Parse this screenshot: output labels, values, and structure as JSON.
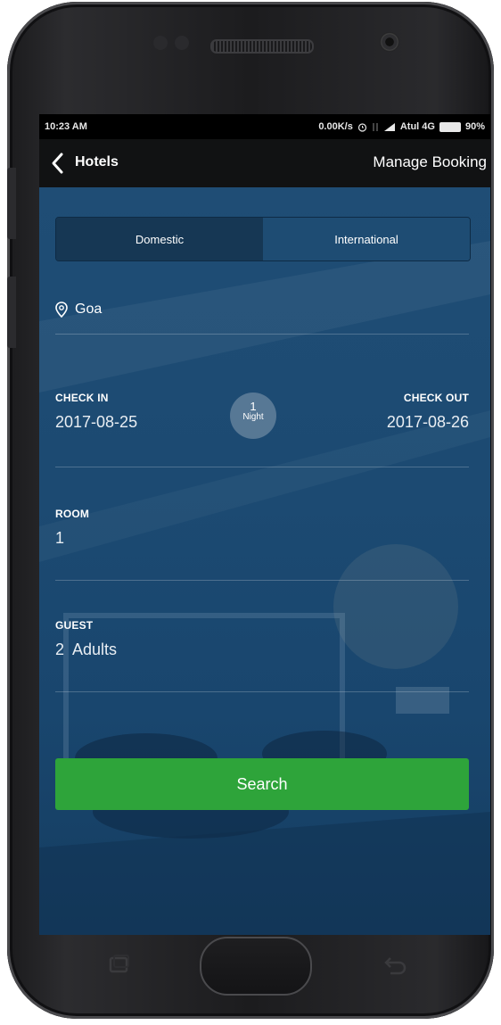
{
  "status_bar": {
    "time": "10:23 AM",
    "net_speed": "0.00K/s",
    "carrier": "Atul 4G",
    "battery": "90%",
    "icons": [
      "alarm-icon",
      "transfer-icon",
      "signal-icon",
      "battery-icon"
    ]
  },
  "app_bar": {
    "title": "Hotels",
    "manage_label": "Manage Booking",
    "back_icon": "chevron-left-icon"
  },
  "tabs": {
    "domestic": "Domestic",
    "international": "International",
    "selected": "Domestic"
  },
  "location": {
    "icon": "location-pin-icon",
    "value": "Goa"
  },
  "dates": {
    "check_in_label": "CHECK IN",
    "check_in_value": "2017-08-25",
    "check_out_label": "CHECK OUT",
    "check_out_value": "2017-08-26",
    "nights_count": "1",
    "nights_label": "Night"
  },
  "room": {
    "label": "ROOM",
    "value": "1"
  },
  "guest": {
    "label": "GUEST",
    "count": "2",
    "unit": "Adults"
  },
  "search": {
    "label": "Search"
  },
  "colors": {
    "accent_green": "#2ea43a",
    "panel_blue": "#1d4b73",
    "app_bar": "#111213"
  }
}
